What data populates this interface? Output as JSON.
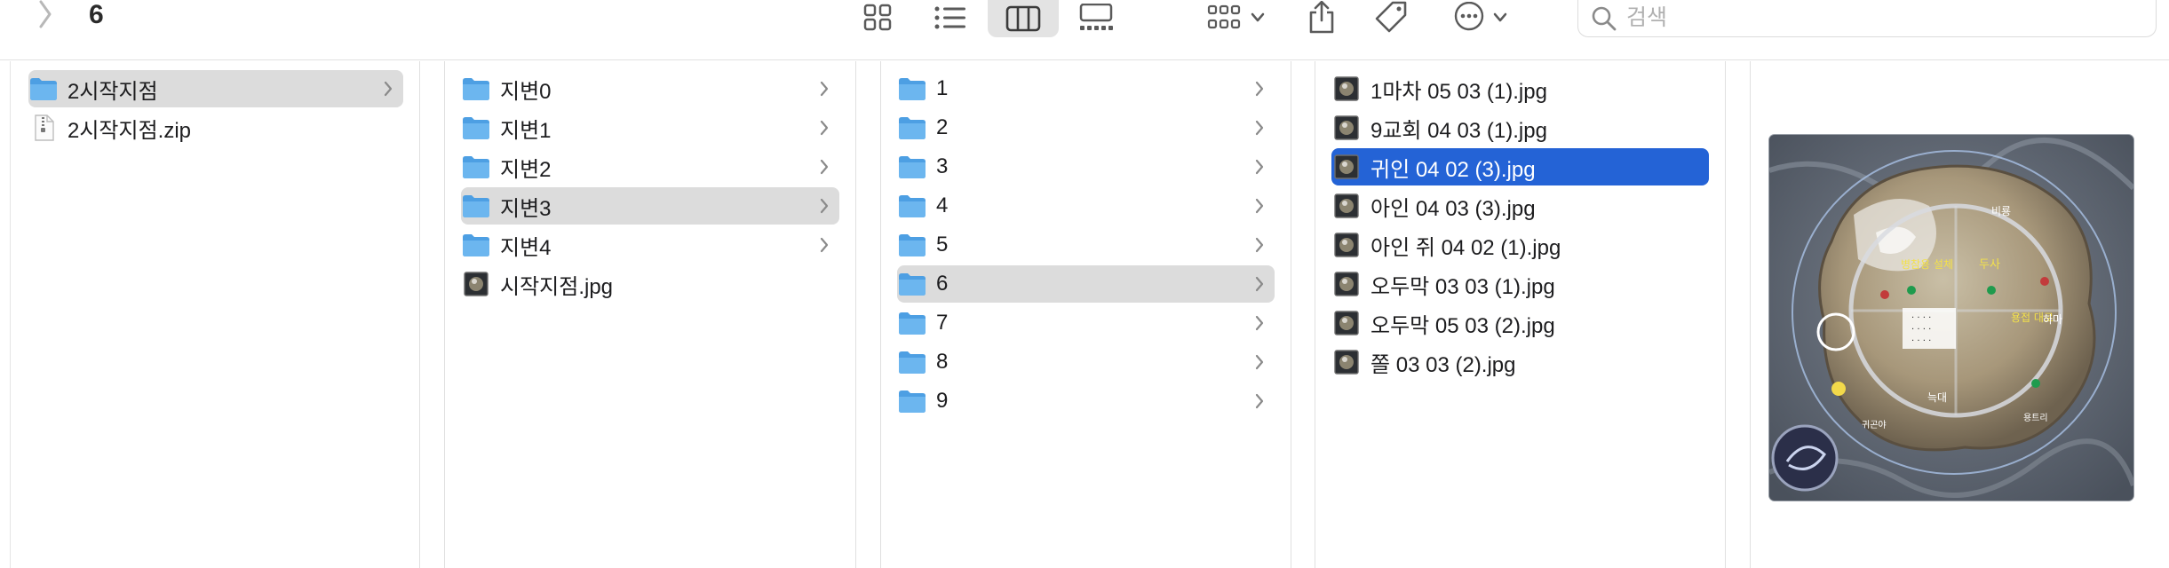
{
  "toolbar": {
    "title": "6",
    "search_placeholder": "검색",
    "icons": [
      "chevron-right-icon",
      "icon-view-icon",
      "list-view-icon",
      "column-view-icon",
      "gallery-view-icon",
      "group-icon",
      "share-icon",
      "tag-icon",
      "more-icon",
      "search-icon"
    ]
  },
  "columns": [
    {
      "items": [
        {
          "label": "2시작지점",
          "type": "folder",
          "selected": "gray",
          "has_children": true
        },
        {
          "label": "2시작지점.zip",
          "type": "zip",
          "selected": "",
          "has_children": false
        }
      ]
    },
    {
      "items": [
        {
          "label": "지변0",
          "type": "folder",
          "selected": "",
          "has_children": true
        },
        {
          "label": "지변1",
          "type": "folder",
          "selected": "",
          "has_children": true
        },
        {
          "label": "지변2",
          "type": "folder",
          "selected": "",
          "has_children": true
        },
        {
          "label": "지변3",
          "type": "folder",
          "selected": "gray",
          "has_children": true
        },
        {
          "label": "지변4",
          "type": "folder",
          "selected": "",
          "has_children": true
        },
        {
          "label": "시작지점.jpg",
          "type": "image",
          "selected": "",
          "has_children": false
        }
      ]
    },
    {
      "items": [
        {
          "label": "1",
          "type": "folder",
          "selected": "",
          "has_children": true
        },
        {
          "label": "2",
          "type": "folder",
          "selected": "",
          "has_children": true
        },
        {
          "label": "3",
          "type": "folder",
          "selected": "",
          "has_children": true
        },
        {
          "label": "4",
          "type": "folder",
          "selected": "",
          "has_children": true
        },
        {
          "label": "5",
          "type": "folder",
          "selected": "",
          "has_children": true
        },
        {
          "label": "6",
          "type": "folder",
          "selected": "gray",
          "has_children": true
        },
        {
          "label": "7",
          "type": "folder",
          "selected": "",
          "has_children": true
        },
        {
          "label": "8",
          "type": "folder",
          "selected": "",
          "has_children": true
        },
        {
          "label": "9",
          "type": "folder",
          "selected": "",
          "has_children": true
        }
      ]
    },
    {
      "items": [
        {
          "label": "1마차 05 03 (1).jpg",
          "type": "image",
          "selected": "",
          "has_children": false
        },
        {
          "label": "9교회 04 03 (1).jpg",
          "type": "image",
          "selected": "",
          "has_children": false
        },
        {
          "label": "귀인 04 02 (3).jpg",
          "type": "image",
          "selected": "blue",
          "has_children": false
        },
        {
          "label": "아인 04 03 (3).jpg",
          "type": "image",
          "selected": "",
          "has_children": false
        },
        {
          "label": "아인 쥐 04 02 (1).jpg",
          "type": "image",
          "selected": "",
          "has_children": false
        },
        {
          "label": "오두막 03 03 (1).jpg",
          "type": "image",
          "selected": "",
          "has_children": false
        },
        {
          "label": "오두막 05 03 (2).jpg",
          "type": "image",
          "selected": "",
          "has_children": false
        },
        {
          "label": "쫄 03 03 (2).jpg",
          "type": "image",
          "selected": "",
          "has_children": false
        }
      ]
    }
  ],
  "colors": {
    "folder": "#6cb6ef",
    "folder_dark": "#4d9fe3",
    "selection_gray": "#dcdcdc",
    "selection_blue": "#2463d6",
    "chevron": "#8a8a8a"
  },
  "preview": {
    "selected_file_index": 2,
    "map_labels": [
      "비룡",
      "병참용 설체",
      "두사",
      "용접 대로",
      "하마",
      "늑대",
      "귀곤야",
      "용트리"
    ]
  }
}
